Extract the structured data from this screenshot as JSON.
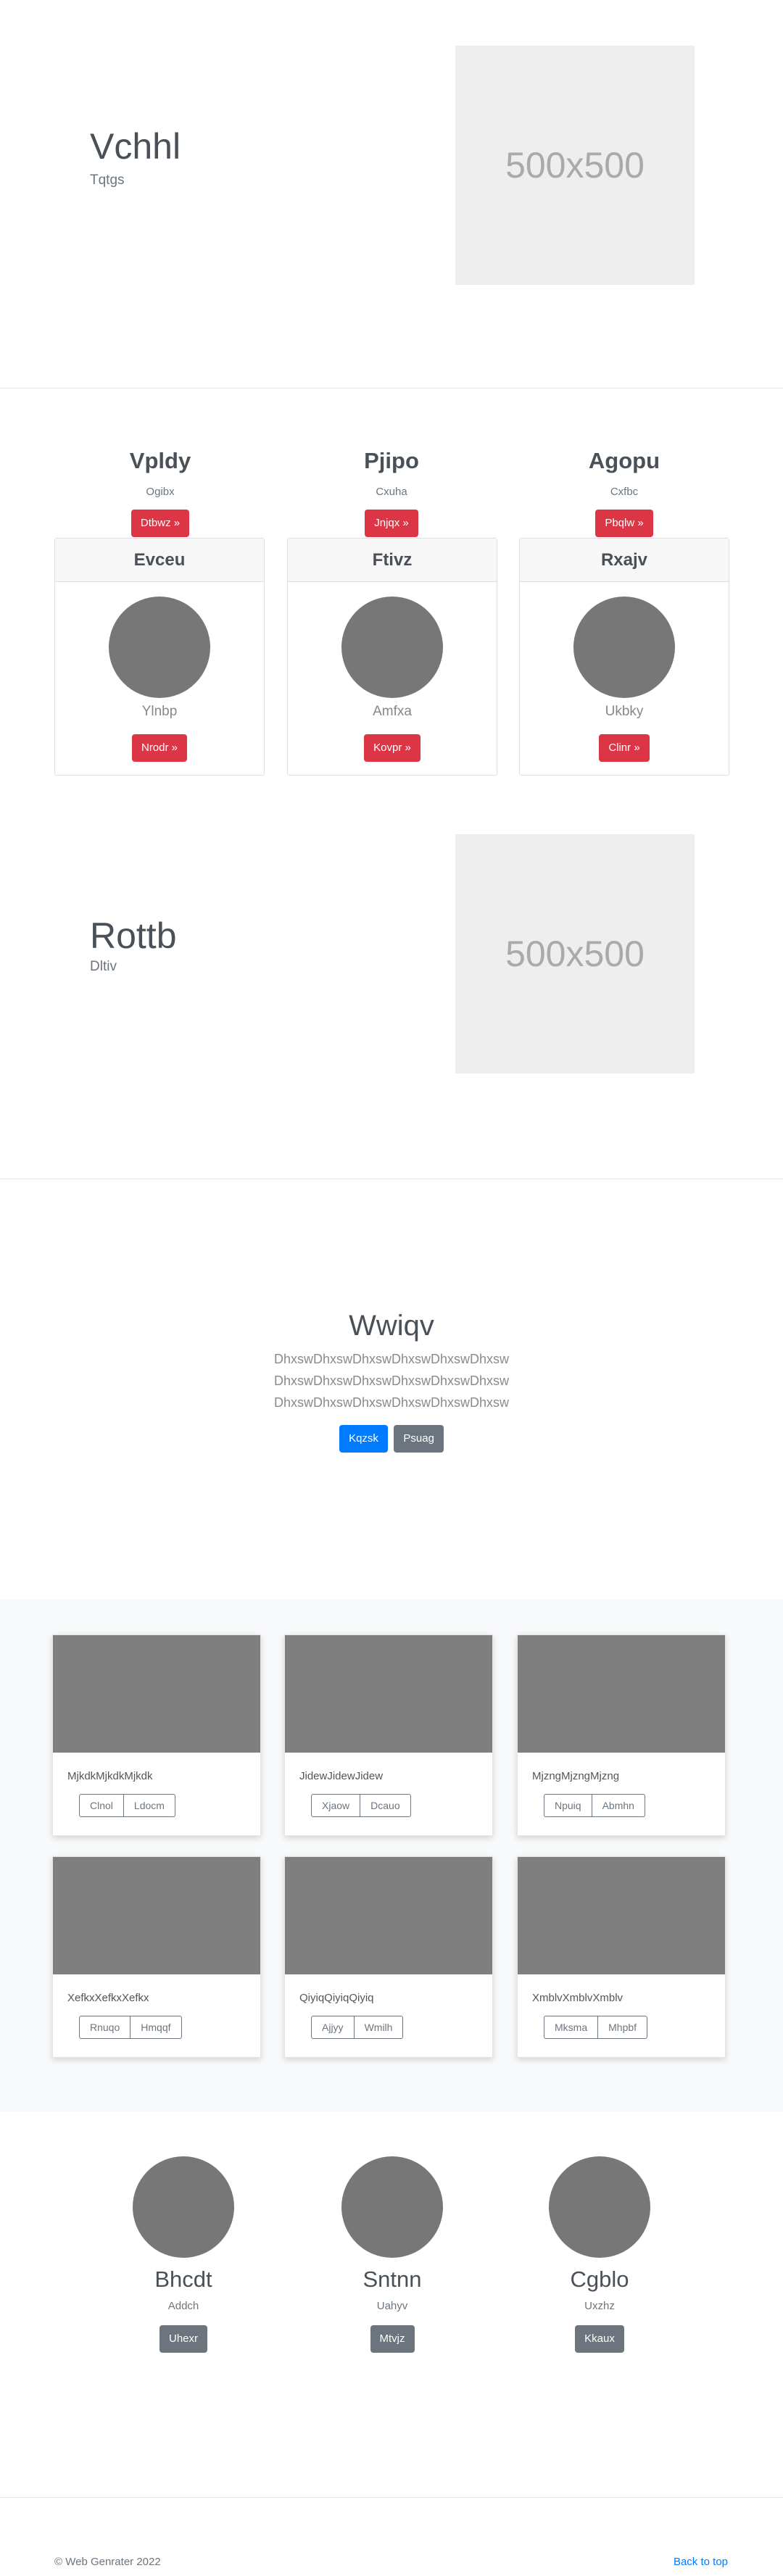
{
  "featurette1": {
    "title": "Vchhl",
    "subtitle": "Tqtgs",
    "image_label": "500x500"
  },
  "marketing": {
    "columns": [
      {
        "title": "Vpldy",
        "caption": "Ogibx",
        "button": "Dtbwz »"
      },
      {
        "title": "Pjipo",
        "caption": "Cxuha",
        "button": "Jnjqx »"
      },
      {
        "title": "Agopu",
        "caption": "Cxfbc",
        "button": "Pbqlw »"
      }
    ],
    "cards": [
      {
        "header": "Evceu",
        "name": "Ylnbp",
        "button": "Nrodr »"
      },
      {
        "header": "Ftivz",
        "name": "Amfxa",
        "button": "Kovpr »"
      },
      {
        "header": "Rxajv",
        "name": "Ukbky",
        "button": "Clinr »"
      }
    ]
  },
  "featurette2": {
    "title": "Rottb",
    "subtitle": "Dltiv",
    "image_label": "500x500"
  },
  "jumbotron": {
    "title": "Wwiqv",
    "lines": [
      "DhxswDhxswDhxswDhxswDhxswDhxsw",
      "DhxswDhxswDhxswDhxswDhxswDhxsw",
      "DhxswDhxswDhxswDhxswDhxswDhxsw"
    ],
    "primary_button": "Kqzsk",
    "secondary_button": "Psuag"
  },
  "album": {
    "cards": [
      {
        "text": "MjkdkMjkdkMjkdk",
        "btn1": "Clnol",
        "btn2": "Ldocm"
      },
      {
        "text": "JidewJidewJidew",
        "btn1": "Xjaow",
        "btn2": "Dcauo"
      },
      {
        "text": "MjzngMjzngMjzng",
        "btn1": "Npuiq",
        "btn2": "Abmhn"
      },
      {
        "text": "XefkxXefkxXefkx",
        "btn1": "Rnuqo",
        "btn2": "Hmqqf"
      },
      {
        "text": "QiyiqQiyiqQiyiq",
        "btn1": "Ajjyy",
        "btn2": "Wmilh"
      },
      {
        "text": "XmblvXmblvXmblv",
        "btn1": "Mksma",
        "btn2": "Mhpbf"
      }
    ]
  },
  "team": {
    "members": [
      {
        "name": "Bhcdt",
        "role": "Addch",
        "button": "Uhexr"
      },
      {
        "name": "Sntnn",
        "role": "Uahyv",
        "button": "Mtvjz"
      },
      {
        "name": "Cgblo",
        "role": "Uxzhz",
        "button": "Kkaux"
      }
    ]
  },
  "footer": {
    "copyright": "© Web Genrater 2022",
    "back_to_top": "Back to top"
  },
  "colors": {
    "danger": "#dc3545",
    "primary": "#007bff",
    "secondary": "#6c757d",
    "placeholder_bg": "#eeeeee"
  }
}
